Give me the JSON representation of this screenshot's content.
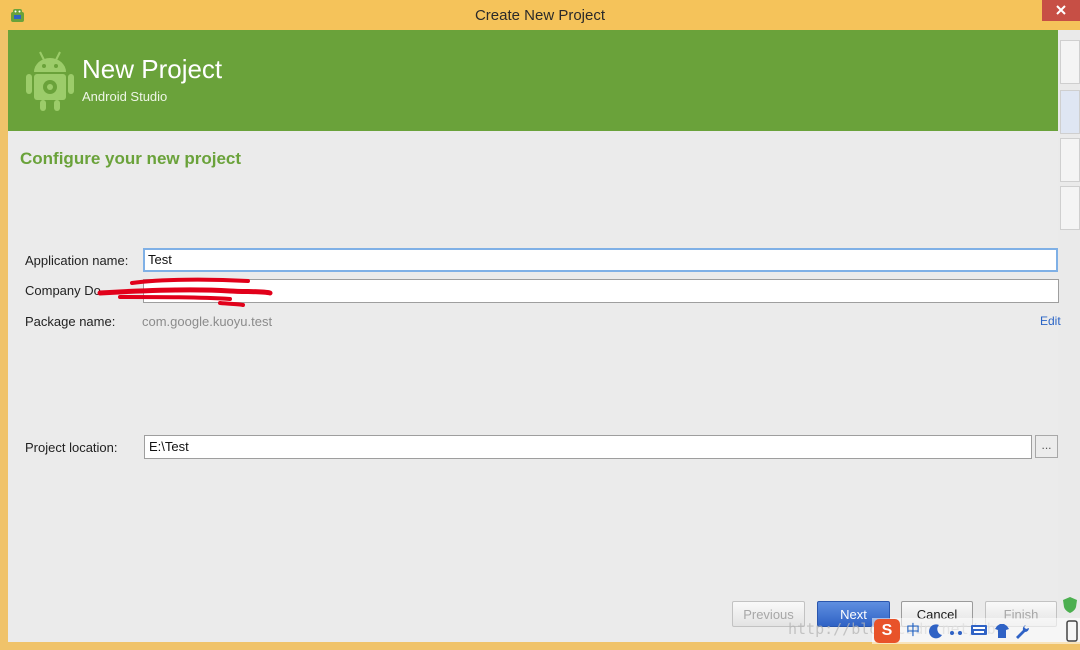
{
  "window": {
    "title": "Create New Project"
  },
  "banner": {
    "title": "New Project",
    "subtitle": "Android Studio"
  },
  "page": {
    "section_title": "Configure your new project"
  },
  "form": {
    "app_name_label": "Application name:",
    "app_name_value": "Test",
    "company_label": "Company Do",
    "company_value": "",
    "package_label": "Package name:",
    "package_value": "com.google.kuoyu.test",
    "edit_link": "Edit",
    "location_label": "Project location:",
    "location_value": "E:\\Test",
    "browse_label": "..."
  },
  "buttons": {
    "previous": "Previous",
    "next": "Next",
    "cancel": "Cancel",
    "finish": "Finish"
  },
  "tray": {
    "ime_logo": "S",
    "ime_mode": "中",
    "watermark": "http://blog.csdn.net/abc"
  },
  "colors": {
    "titlebar": "#f5c35a",
    "banner_green": "#6aa23a",
    "section_title_green": "#6aa23a",
    "focus_blue": "#7fb0e6",
    "primary_button": "#2f62c5",
    "redaction_red": "#e1001a"
  },
  "icons": {
    "app": "android-studio-icon",
    "banner": "android-robot-gear-icon",
    "close": "close-icon"
  }
}
